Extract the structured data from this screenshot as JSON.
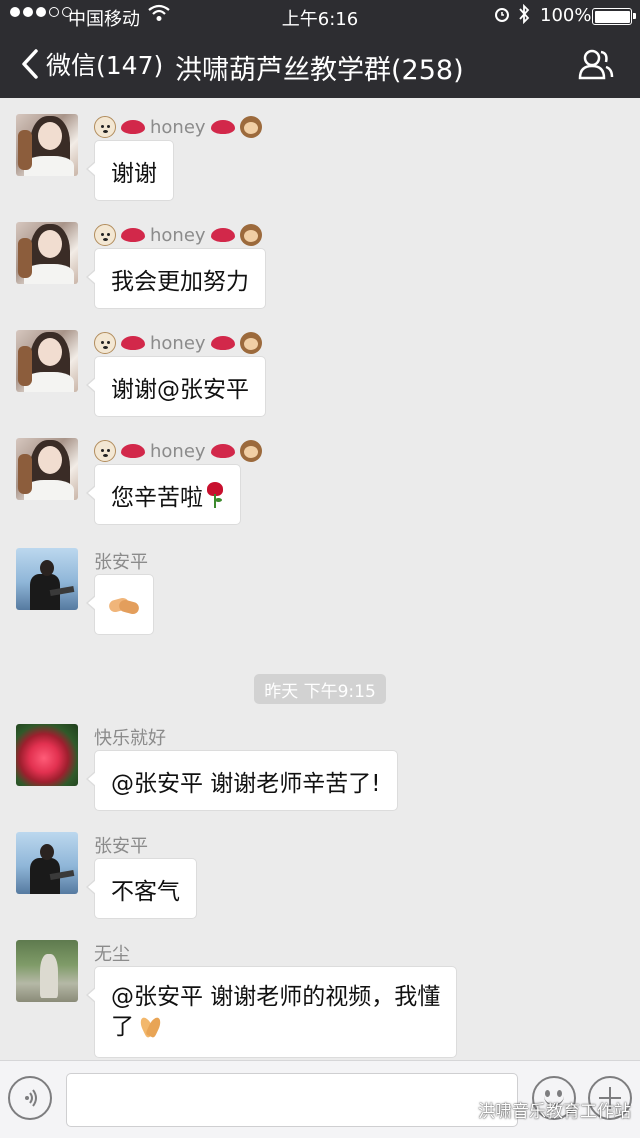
{
  "status_bar": {
    "carrier": "中国移动",
    "time": "上午6:16",
    "battery": "100%"
  },
  "nav": {
    "back_label": "微信(147)",
    "title": "洪啸葫芦丝教学群(258)"
  },
  "messages": [
    {
      "sender": "honey",
      "text": "谢谢",
      "avatar": "avatar-honey"
    },
    {
      "sender": "honey",
      "text": "我会更加努力",
      "avatar": "avatar-honey"
    },
    {
      "sender": "honey",
      "text": "谢谢@张安平",
      "avatar": "avatar-honey"
    },
    {
      "sender": "honey",
      "text": "您辛苦啦",
      "emoji": "rose-icon",
      "avatar": "avatar-honey"
    },
    {
      "sender": "张安平",
      "text": "",
      "emoji": "handshake-icon",
      "avatar": "avatar-zhang"
    },
    {
      "sender": "快乐就好",
      "text": "@张安平 谢谢老师辛苦了!",
      "avatar": "avatar-kuaile"
    },
    {
      "sender": "张安平",
      "text": "不客气",
      "avatar": "avatar-zhang"
    },
    {
      "sender": "无尘",
      "text_line1": "@张安平 谢谢老师的视频，我懂",
      "text_line2": "了",
      "emoji": "pray-icon",
      "avatar": "avatar-wuchen"
    }
  ],
  "timestamp": "昨天 下午9:15",
  "watermark": "洪啸音乐教育工作站",
  "colors": {
    "nav_bg": "#2d2d31",
    "chat_bg": "#ebebeb",
    "bubble_bg": "#ffffff",
    "sender_text": "#8b8b8b"
  }
}
